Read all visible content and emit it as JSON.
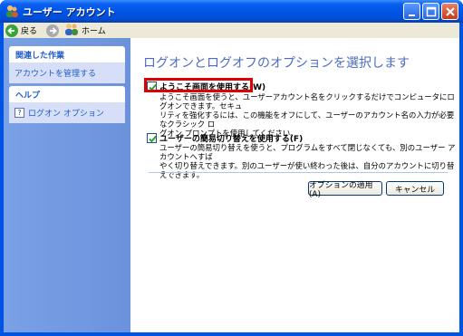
{
  "window": {
    "title": "ユーザー アカウント",
    "accent": "#0054e3"
  },
  "toolbar": {
    "back_label": "戻る",
    "home_label": "ホーム"
  },
  "sidebar": {
    "related_tasks": {
      "title": "関連した作業",
      "items": [
        "アカウントを管理する"
      ]
    },
    "help": {
      "title": "ヘルプ",
      "items": [
        "ログオン オプション"
      ]
    }
  },
  "main": {
    "title": "ログオンとログオフのオプションを選択します",
    "options": [
      {
        "label": "ようこそ画面を使用する(W)",
        "checked": true,
        "desc": [
          "ようこそ画面を使うと、ユーザーアカウント名をクリックするだけでコンピュータにログオンできます。セキュ",
          "リティを強化するには、この機能をオフにして、ユーザーのアカウント名の入力が必要なクラシック ロ",
          "グオン プロンプトを使用してください。"
        ]
      },
      {
        "label": "ユーザーの簡易切り替えを使用する(F)",
        "checked": true,
        "desc": [
          "ユーザーの簡易切り替えを使うと、プログラムをすべて閉じなくても、別のユーザー アカウントへすば",
          "やく切り替えできます。別のユーザーが使い終わった後は、自分のアカウントに切り替えできます。"
        ]
      }
    ],
    "apply_button": "オプションの適用(A)",
    "cancel_button": "キャンセル"
  }
}
